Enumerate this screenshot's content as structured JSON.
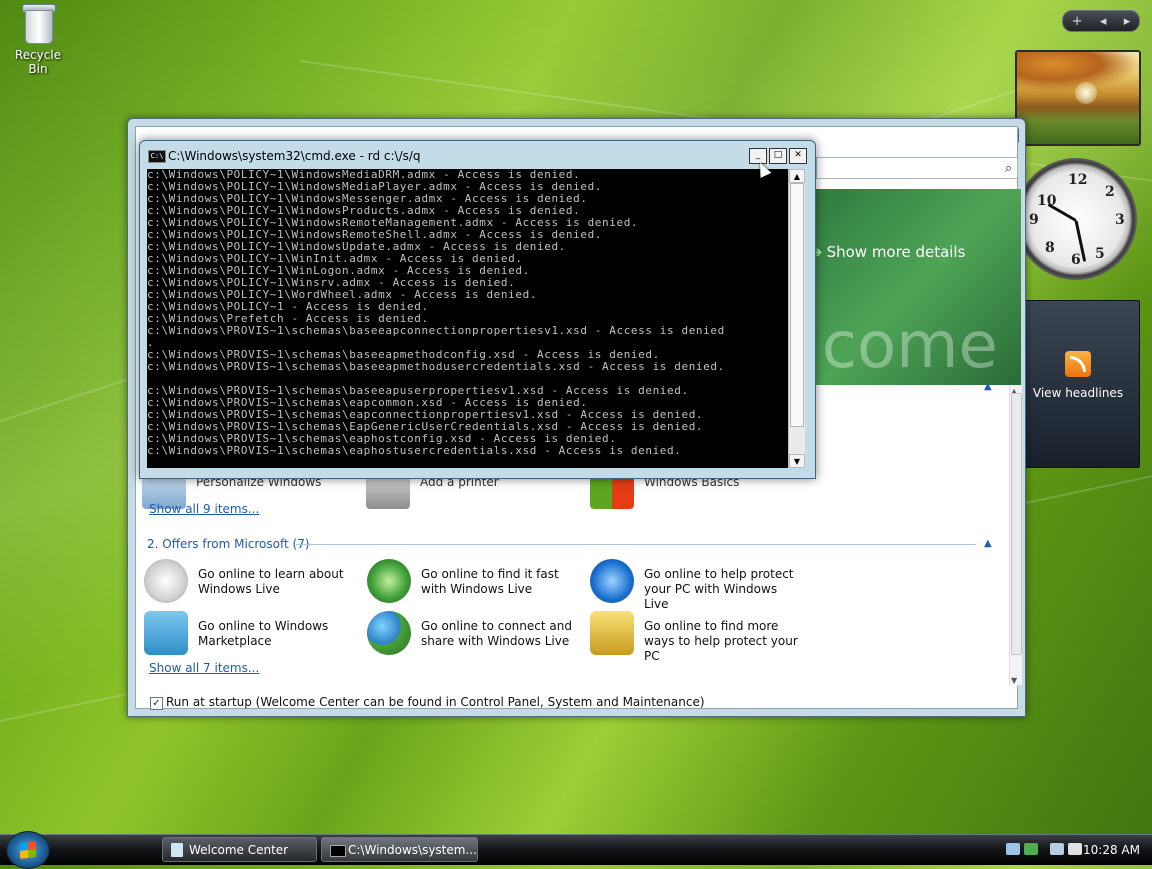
{
  "desktop": {
    "recycle_bin_label": "Recycle Bin"
  },
  "sidebar": {
    "controls": {
      "add": "+",
      "prev": "◂",
      "next": "▸"
    },
    "feed_label": "View headlines"
  },
  "welcome_center": {
    "show_more": "Show more details",
    "watermark": "lcome",
    "show_all_1": "Show all 9 items...",
    "section2_title": "2. Offers from Microsoft (7)",
    "offers": [
      {
        "text": "Go online to learn about Windows Live"
      },
      {
        "text": "Go online to find it fast with Windows Live"
      },
      {
        "text": "Go online to help protect your PC with Windows Live"
      },
      {
        "text": "Go online to Windows Marketplace"
      },
      {
        "text": "Go online to connect and share with Windows Live"
      },
      {
        "text": "Go online to find more ways to help protect your PC"
      }
    ],
    "partial_items": [
      "Personalize Windows",
      "Add a printer",
      "Windows Basics"
    ],
    "show_all_2": "Show all 7 items...",
    "startup_label": "Run at startup (Welcome Center can be found in Control Panel, System and Maintenance)",
    "startup_checked": true
  },
  "cmd": {
    "title": "C:\\Windows\\system32\\cmd.exe - rd  c:\\/s/q",
    "lines": [
      "c:\\Windows\\POLICY~1\\WindowsMediaDRM.admx - Access is denied.",
      "c:\\Windows\\POLICY~1\\WindowsMediaPlayer.admx - Access is denied.",
      "c:\\Windows\\POLICY~1\\WindowsMessenger.admx - Access is denied.",
      "c:\\Windows\\POLICY~1\\WindowsProducts.admx - Access is denied.",
      "c:\\Windows\\POLICY~1\\WindowsRemoteManagement.admx - Access is denied.",
      "c:\\Windows\\POLICY~1\\WindowsRemoteShell.admx - Access is denied.",
      "c:\\Windows\\POLICY~1\\WindowsUpdate.admx - Access is denied.",
      "c:\\Windows\\POLICY~1\\WinInit.admx - Access is denied.",
      "c:\\Windows\\POLICY~1\\WinLogon.admx - Access is denied.",
      "c:\\Windows\\POLICY~1\\Winsrv.admx - Access is denied.",
      "c:\\Windows\\POLICY~1\\WordWheel.admx - Access is denied.",
      "c:\\Windows\\POLICY~1 - Access is denied.",
      "c:\\Windows\\Prefetch - Access is denied.",
      "c:\\Windows\\PROVIS~1\\schemas\\baseeapconnectionpropertiesv1.xsd - Access is denied",
      ".",
      "c:\\Windows\\PROVIS~1\\schemas\\baseeapmethodconfig.xsd - Access is denied.",
      "c:\\Windows\\PROVIS~1\\schemas\\baseeapmethodusercredentials.xsd - Access is denied.",
      "",
      "c:\\Windows\\PROVIS~1\\schemas\\baseeapuserpropertiesv1.xsd - Access is denied.",
      "c:\\Windows\\PROVIS~1\\schemas\\eapcommon.xsd - Access is denied.",
      "c:\\Windows\\PROVIS~1\\schemas\\eapconnectionpropertiesv1.xsd - Access is denied.",
      "c:\\Windows\\PROVIS~1\\schemas\\EapGenericUserCredentials.xsd - Access is denied.",
      "c:\\Windows\\PROVIS~1\\schemas\\eaphostconfig.xsd - Access is denied.",
      "c:\\Windows\\PROVIS~1\\schemas\\eaphostusercredentials.xsd - Access is denied."
    ]
  },
  "taskbar": {
    "items": [
      {
        "label": "Welcome Center"
      },
      {
        "label": "C:\\Windows\\system..."
      }
    ],
    "time": "10:28 AM"
  },
  "colors": {
    "link": "#1d5bb1",
    "console_bg": "#000000",
    "console_fg": "#c0c0c0"
  }
}
